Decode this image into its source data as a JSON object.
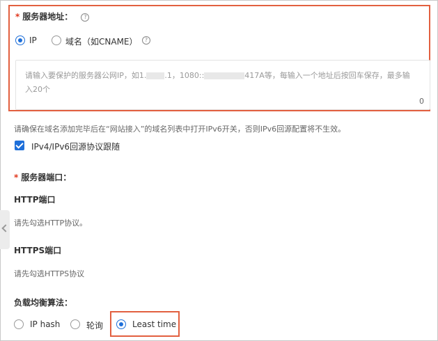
{
  "server_address": {
    "required_mark": "*",
    "label": "服务器地址：",
    "help_icon": "help-circle-icon",
    "options": [
      {
        "label": "IP",
        "selected": true
      },
      {
        "label": "域名（如CNAME）",
        "selected": false
      }
    ],
    "placeholder_part1": "请输入要保护的服务器公网IP，如1.",
    "placeholder_part2": ".1，1080::",
    "placeholder_part3": "417A等，每输入一个地址后按回车保存，最多输入20个",
    "counter": "0"
  },
  "ipv6_hint": "请确保在域名添加完毕后在“网站接入”的域名列表中打开IPv6开关，否则IPv6回源配置将不生效。",
  "follow_protocol": {
    "label": "IPv4/IPv6回源协议跟随",
    "checked": true
  },
  "server_port": {
    "required_mark": "*",
    "label": "服务器端口：",
    "http_title": "HTTP端口",
    "http_hint": "请先勾选HTTP协议。",
    "https_title": "HTTPS端口",
    "https_hint": "请先勾选HTTPS协议"
  },
  "lb_algorithm": {
    "label": "负载均衡算法：",
    "options": [
      {
        "label": "IP hash",
        "selected": false
      },
      {
        "label": "轮询",
        "selected": false
      },
      {
        "label": "Least time",
        "selected": true
      }
    ]
  },
  "colors": {
    "highlight": "#e25f3f",
    "accent": "#1e6fd9",
    "required": "#e0361c"
  }
}
